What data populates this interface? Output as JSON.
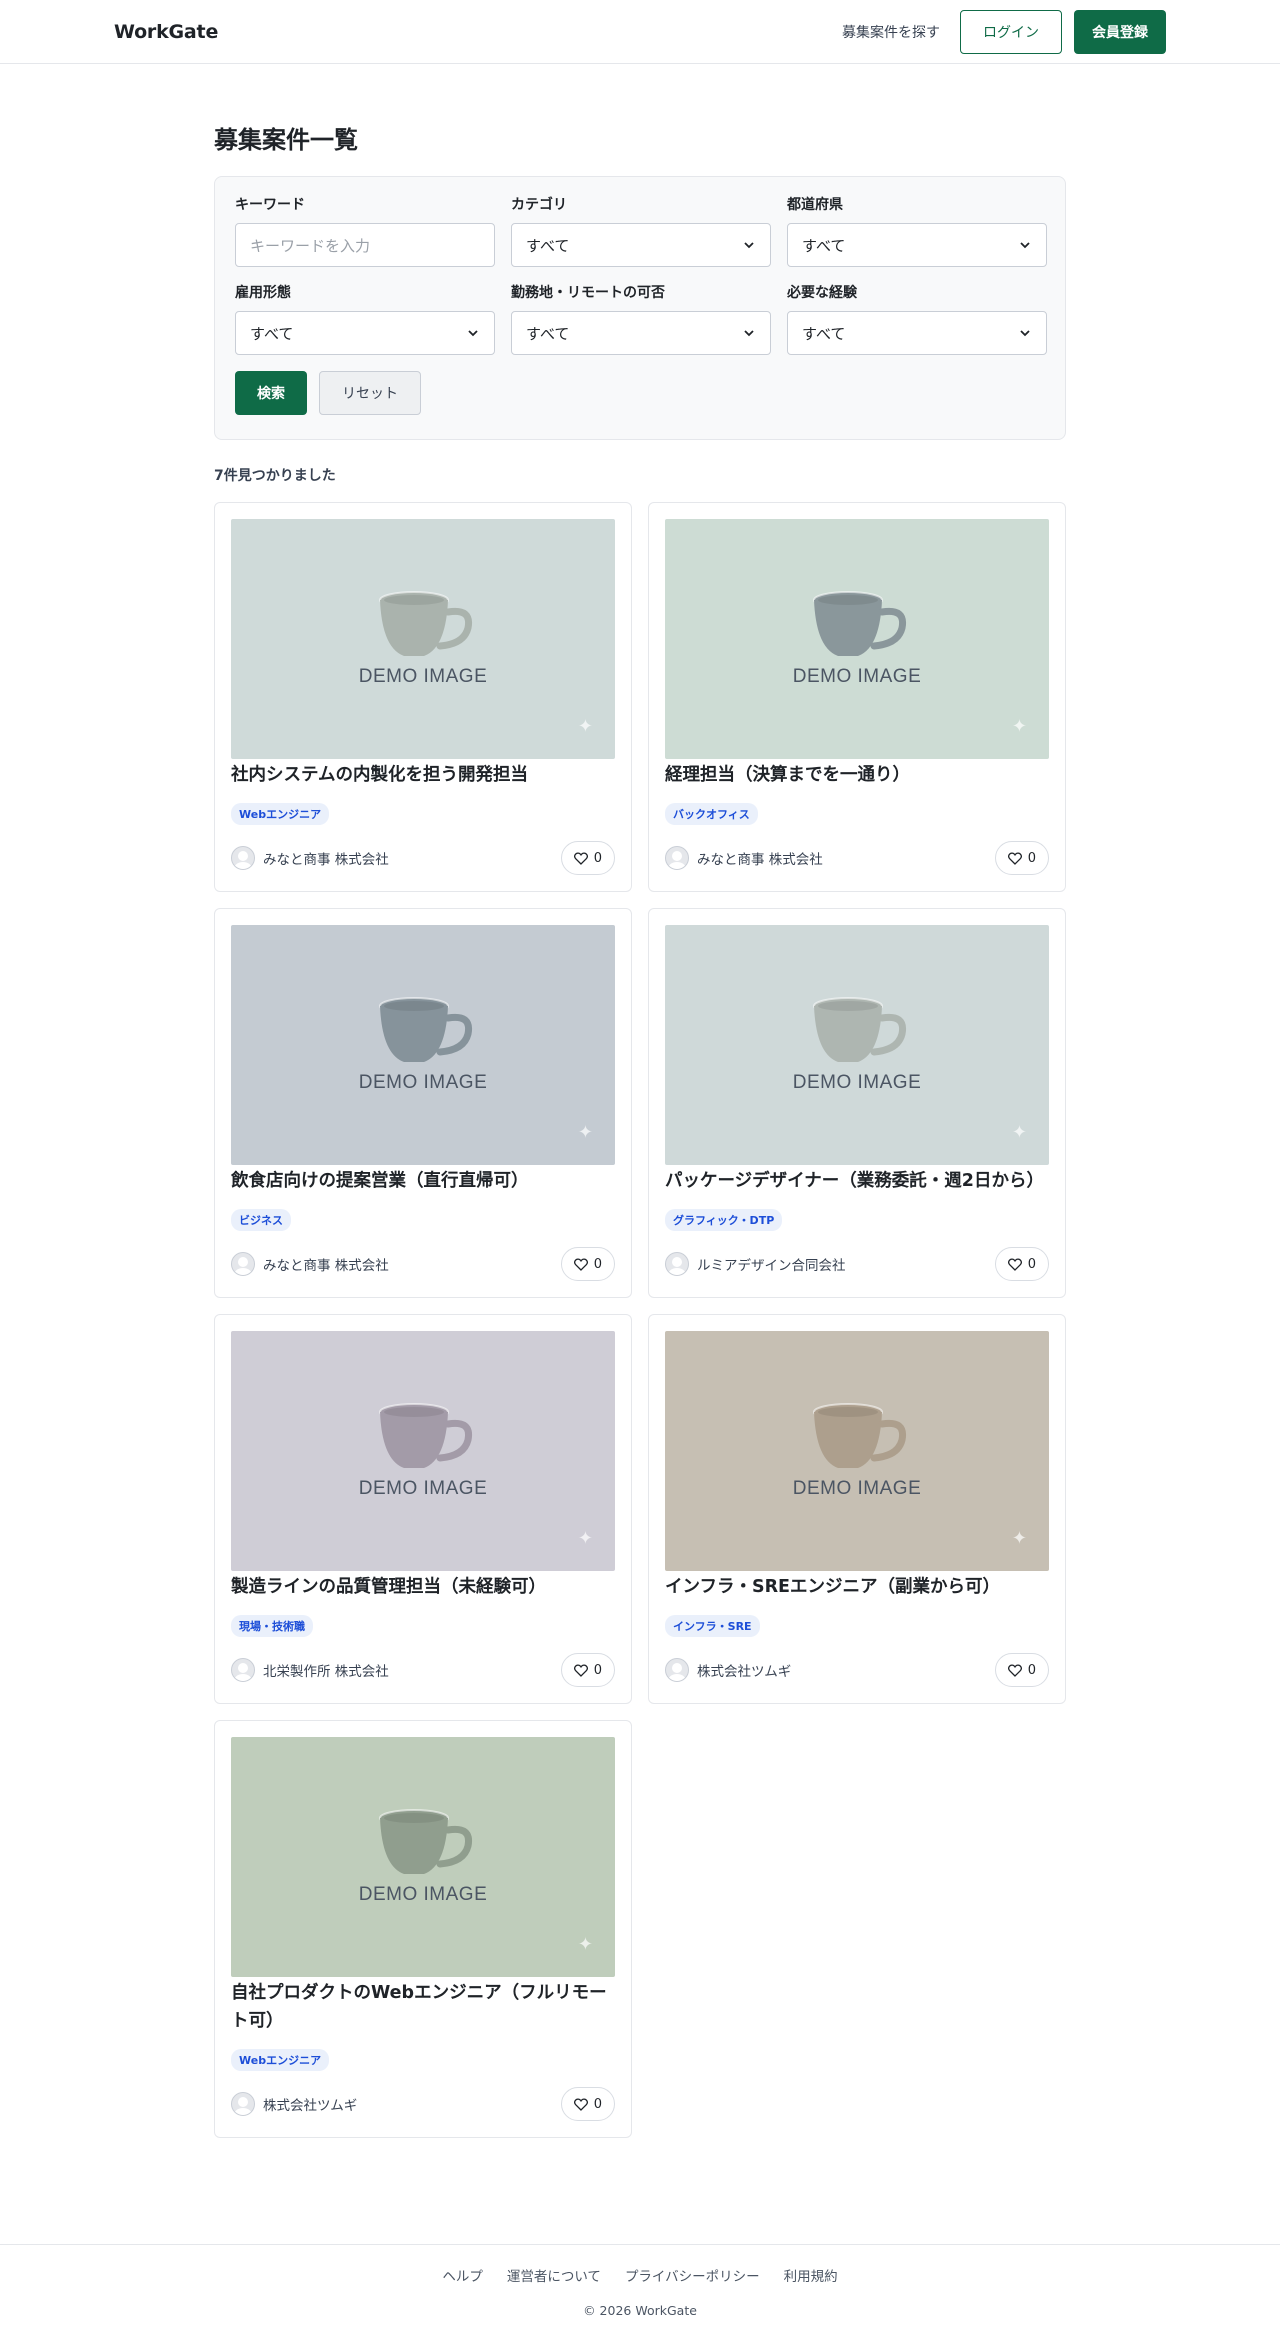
{
  "header": {
    "logo": "WorkGate",
    "nav_find": "募集案件を探す",
    "login": "ログイン",
    "register": "会員登録"
  },
  "page": {
    "title": "募集案件一覧",
    "result_count": "7件見つかりました"
  },
  "filters": {
    "keyword": {
      "label": "キーワード",
      "placeholder": "キーワードを入力"
    },
    "category": {
      "label": "カテゴリ",
      "value": "すべて"
    },
    "prefecture": {
      "label": "都道府県",
      "value": "すべて"
    },
    "employment": {
      "label": "雇用形態",
      "value": "すべて"
    },
    "remote": {
      "label": "勤務地・リモートの可否",
      "value": "すべて"
    },
    "experience": {
      "label": "必要な経験",
      "value": "すべて"
    },
    "search": "検索",
    "reset": "リセット"
  },
  "thumb_label": "DEMO IMAGE",
  "jobs": [
    {
      "title": "社内システムの内製化を担う開発担当",
      "tag": "Webエンジニア",
      "company": "みなと商事 株式会社",
      "likes": "0",
      "bg": "#cfdad9",
      "cup": "#aab3ad"
    },
    {
      "title": "経理担当（決算までを一通り）",
      "tag": "バックオフィス",
      "company": "みなと商事 株式会社",
      "likes": "0",
      "bg": "#cddcd4",
      "cup": "#8a979b"
    },
    {
      "title": "飲食店向けの提案営業（直行直帰可）",
      "tag": "ビジネス",
      "company": "みなと商事 株式会社",
      "likes": "0",
      "bg": "#c4cbd2",
      "cup": "#86939b"
    },
    {
      "title": "パッケージデザイナー（業務委託・週2日から）",
      "tag": "グラフィック・DTP",
      "company": "ルミアデザイン合同会社",
      "likes": "0",
      "bg": "#cfd9d9",
      "cup": "#aeb6b1"
    },
    {
      "title": "製造ラインの品質管理担当（未経験可）",
      "tag": "現場・技術職",
      "company": "北栄製作所 株式会社",
      "likes": "0",
      "bg": "#cfcdd6",
      "cup": "#a39ba8"
    },
    {
      "title": "インフラ・SREエンジニア（副業から可）",
      "tag": "インフラ・SRE",
      "company": "株式会社ツムギ",
      "likes": "0",
      "bg": "#c6bfb3",
      "cup": "#ad9f8d"
    },
    {
      "title": "自社プロダクトのWebエンジニア（フルリモート可）",
      "tag": "Webエンジニア",
      "company": "株式会社ツムギ",
      "likes": "0",
      "bg": "#bfcdbb",
      "cup": "#909e8e"
    }
  ],
  "footer": {
    "links": [
      "ヘルプ",
      "運営者について",
      "プライバシーポリシー",
      "利用規約"
    ],
    "copyright": "© 2026 WorkGate"
  },
  "colors": {
    "accent": "#0f6b47",
    "tag_text": "#1d4ed8",
    "tag_bg": "#eaf0fb"
  },
  "icons": {
    "like": "heart-icon",
    "avatar": "avatar-icon",
    "select": "chevron-down-icon"
  }
}
